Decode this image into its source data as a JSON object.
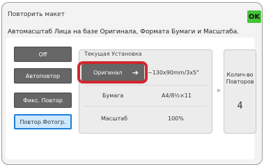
{
  "header": {
    "title": "Повторить макет",
    "subtitle": "Автомасштаб Лица на базе Оригинала, Формата Бумаги и Масштаба.",
    "ok_label": "OK"
  },
  "modes": [
    {
      "label": "Off",
      "active": false
    },
    {
      "label": "Автоповтор",
      "active": false
    },
    {
      "label": "Фикс. Повтор",
      "active": false
    },
    {
      "label": "Повтор.Фотогр.",
      "active": true
    }
  ],
  "settings": {
    "label": "Текущая Установка",
    "original_button": "Оригинал",
    "original_value": "~130x90mm/3x5\"",
    "paper_label": "Бумага",
    "paper_value": "A4/8½×11",
    "scale_label": "Масштаб",
    "scale_value": "100%"
  },
  "copies": {
    "label": "Колич-во Повторов",
    "value": "4"
  },
  "icons": {
    "original_arrow": "arrow-right-icon",
    "panel_caret": "caret-right-icon"
  },
  "colors": {
    "ok_green": "#45c23a",
    "highlight_red": "#d0282e",
    "active_blue_border": "#1d7fd8",
    "active_blue_fill": "#cde9ff",
    "button_gray": "#666666"
  }
}
